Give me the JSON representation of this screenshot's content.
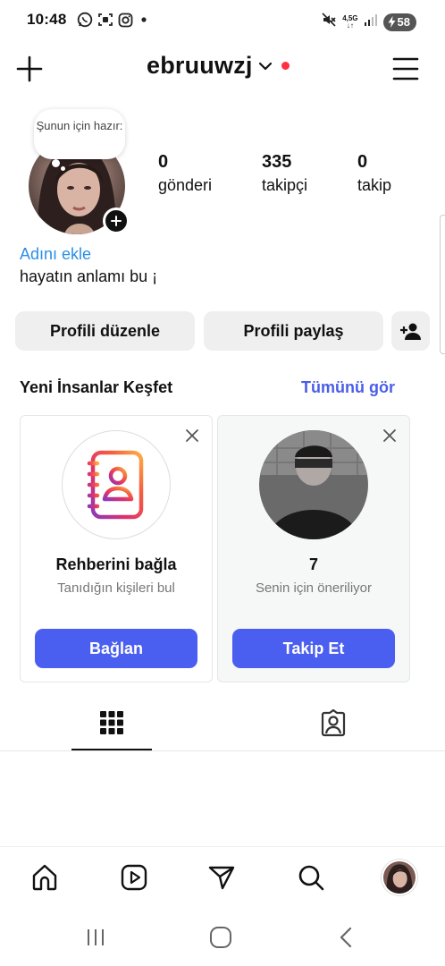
{
  "status_bar": {
    "time": "10:48",
    "net_type_top": "4,5G",
    "net_type_bottom": "↓↑",
    "battery": "58",
    "icons": [
      "whatsapp-icon",
      "screenshot-icon",
      "instagram-icon",
      "dot-icon",
      "mute-icon",
      "signal-icon",
      "battery-icon"
    ]
  },
  "header": {
    "username": "ebruuwzj",
    "icons": [
      "plus-icon",
      "chevron-down-icon",
      "menu-icon"
    ],
    "notification_color": "#ff3040"
  },
  "profile": {
    "note": "Şunun için hazır:",
    "stats": [
      {
        "value": "0",
        "label": "gönderi"
      },
      {
        "value": "335",
        "label": "takipçi"
      },
      {
        "value": "0",
        "label": "takip"
      }
    ],
    "add_name": "Adını ekle",
    "bio": "hayatın anlamı bu ¡",
    "link_color": "#2b8ee8"
  },
  "actions": {
    "edit_profile": "Profili düzenle",
    "share_profile": "Profili paylaş",
    "discover_icon": "person-add-icon"
  },
  "discover": {
    "title": "Yeni İnsanlar Keşfet",
    "see_all": "Tümünü gör",
    "cards": [
      {
        "title": "Rehberini bağla",
        "subtitle": "Tanıdığın kişileri bul",
        "button": "Bağlan",
        "icon": "contacts-book-icon"
      },
      {
        "title": "7",
        "subtitle": "Senin için öneriliyor",
        "button": "Takip Et",
        "icon": "profile-photo"
      }
    ],
    "accent": "#4a5ef0"
  },
  "tabs": {
    "icons": [
      "grid-icon",
      "tagged-icon"
    ]
  },
  "bottom_nav": {
    "icons": [
      "home-icon",
      "reels-icon",
      "direct-icon",
      "search-icon",
      "profile-avatar"
    ]
  },
  "system_nav": {
    "icons": [
      "recents-icon",
      "home-circle-icon",
      "back-icon"
    ]
  }
}
